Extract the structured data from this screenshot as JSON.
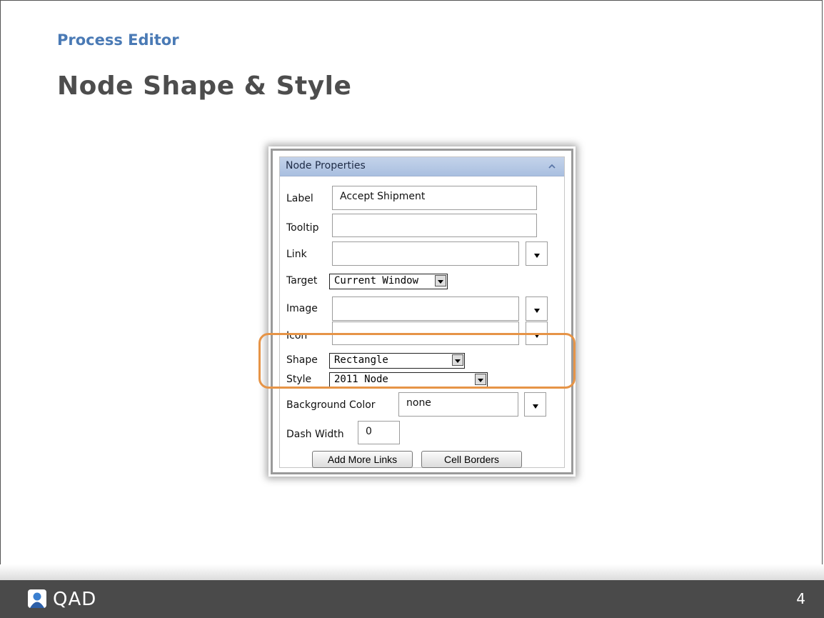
{
  "slide": {
    "section_title": "Process Editor",
    "heading": "Node Shape & Style",
    "page_number": "4"
  },
  "footer": {
    "logo_text": "QAD",
    "background_color": "#4a4a4a"
  },
  "panel": {
    "title": "Node Properties",
    "header_color": "#b8c9e6",
    "fields": {
      "label": {
        "label": "Label",
        "value": "Accept Shipment"
      },
      "tooltip": {
        "label": "Tooltip",
        "value": ""
      },
      "link": {
        "label": "Link",
        "value": ""
      },
      "target": {
        "label": "Target",
        "value": "Current Window"
      },
      "image": {
        "label": "Image",
        "value": ""
      },
      "icon": {
        "label": "Icon",
        "value": ""
      },
      "shape": {
        "label": "Shape",
        "value": "Rectangle"
      },
      "style": {
        "label": "Style",
        "value": "2011 Node"
      },
      "background_color": {
        "label": "Background Color",
        "value": "none"
      },
      "dash_width": {
        "label": "Dash Width",
        "value": "0"
      }
    },
    "buttons": {
      "add_more_links": "Add More Links",
      "cell_borders": "Cell Borders"
    },
    "highlight_color": "#e69447"
  }
}
